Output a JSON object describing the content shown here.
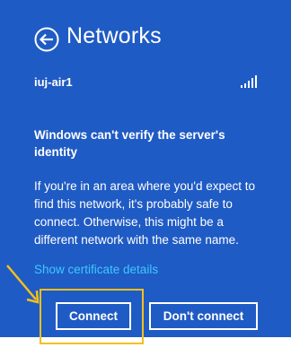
{
  "header": {
    "back_icon": "back-arrow-circle-icon",
    "title": "Networks"
  },
  "network": {
    "name": "iuj-air1",
    "signal_icon": "wifi-signal-bars-icon",
    "signal_bars": 5
  },
  "message": {
    "heading": "Windows can't verify the server's identity",
    "body": "If you're in an area where you'd expect to find this network, it's probably safe to connect. Otherwise, this might be a different network with the same name."
  },
  "links": {
    "certificate": "Show certificate details"
  },
  "buttons": {
    "connect": "Connect",
    "dont_connect": "Don't connect"
  },
  "colors": {
    "panel_background": "#1f5bc4",
    "text": "#ffffff",
    "link": "#3ec8ff",
    "annotation_highlight": "#f4c01a"
  }
}
